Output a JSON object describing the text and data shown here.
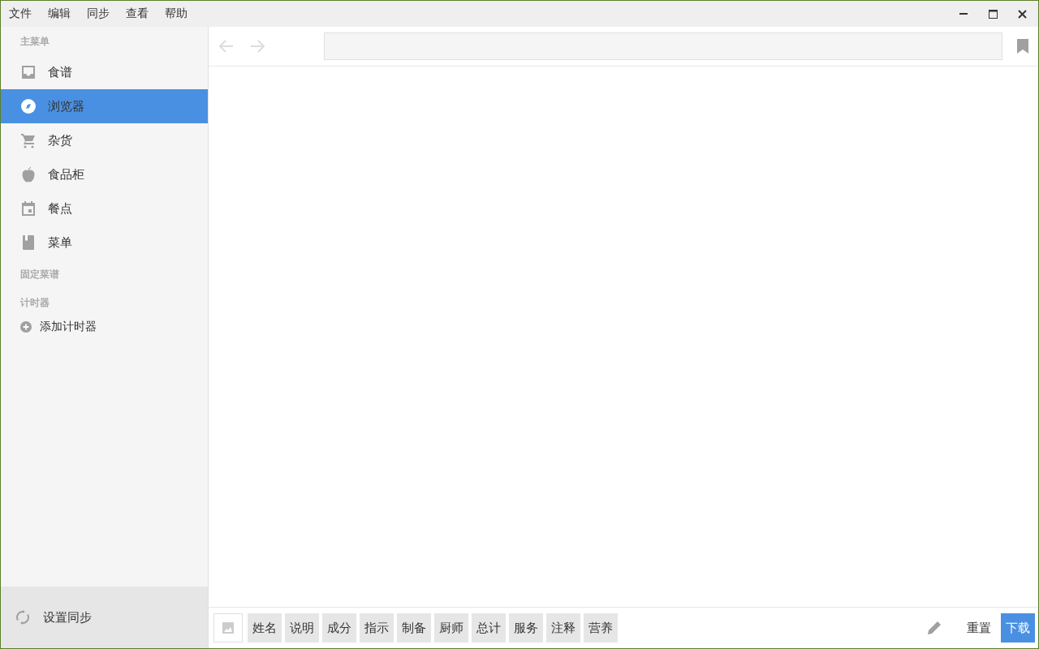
{
  "menu_bar": [
    "文件",
    "编辑",
    "同步",
    "查看",
    "帮助"
  ],
  "sidebar": {
    "sections": [
      {
        "title": "主菜单",
        "items": [
          {
            "label": "食谱",
            "selected": false
          },
          {
            "label": "浏览器",
            "selected": true
          },
          {
            "label": "杂货",
            "selected": false
          },
          {
            "label": "食品柜",
            "selected": false
          },
          {
            "label": "餐点",
            "selected": false
          },
          {
            "label": "菜单",
            "selected": false
          }
        ]
      },
      {
        "title": "固定菜谱"
      },
      {
        "title": "计时器",
        "add_label": "添加计时器"
      }
    ],
    "footer": "设置同步"
  },
  "tag_buttons": [
    "姓名",
    "说明",
    "成分",
    "指示",
    "制备",
    "厨师",
    "总计",
    "服务",
    "注释",
    "营养"
  ],
  "reset_button": "重置",
  "download_button": "下载"
}
